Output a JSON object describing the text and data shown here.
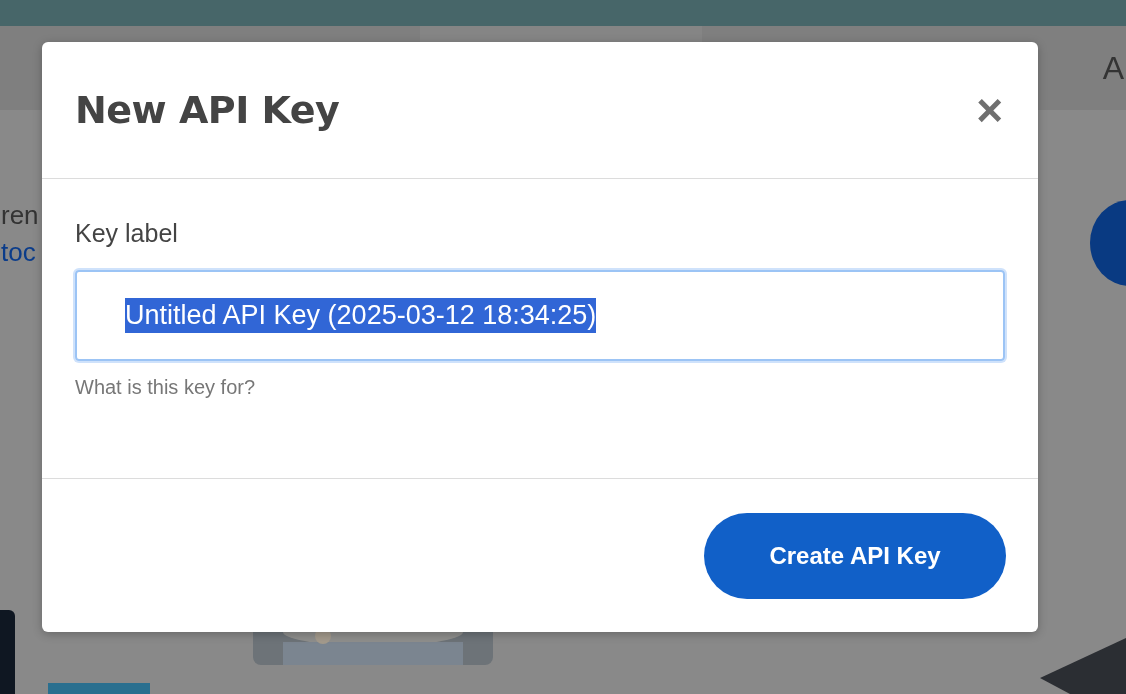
{
  "background": {
    "header_text": "A",
    "text_1": "ren",
    "link_1": "toc"
  },
  "dialog": {
    "title": "New API Key",
    "close": "×",
    "field": {
      "label": "Key label",
      "value": "Untitled API Key (2025-03-12 18:34:25)",
      "value_selected": true,
      "help": "What is this key for?"
    },
    "button": "Create API Key"
  }
}
